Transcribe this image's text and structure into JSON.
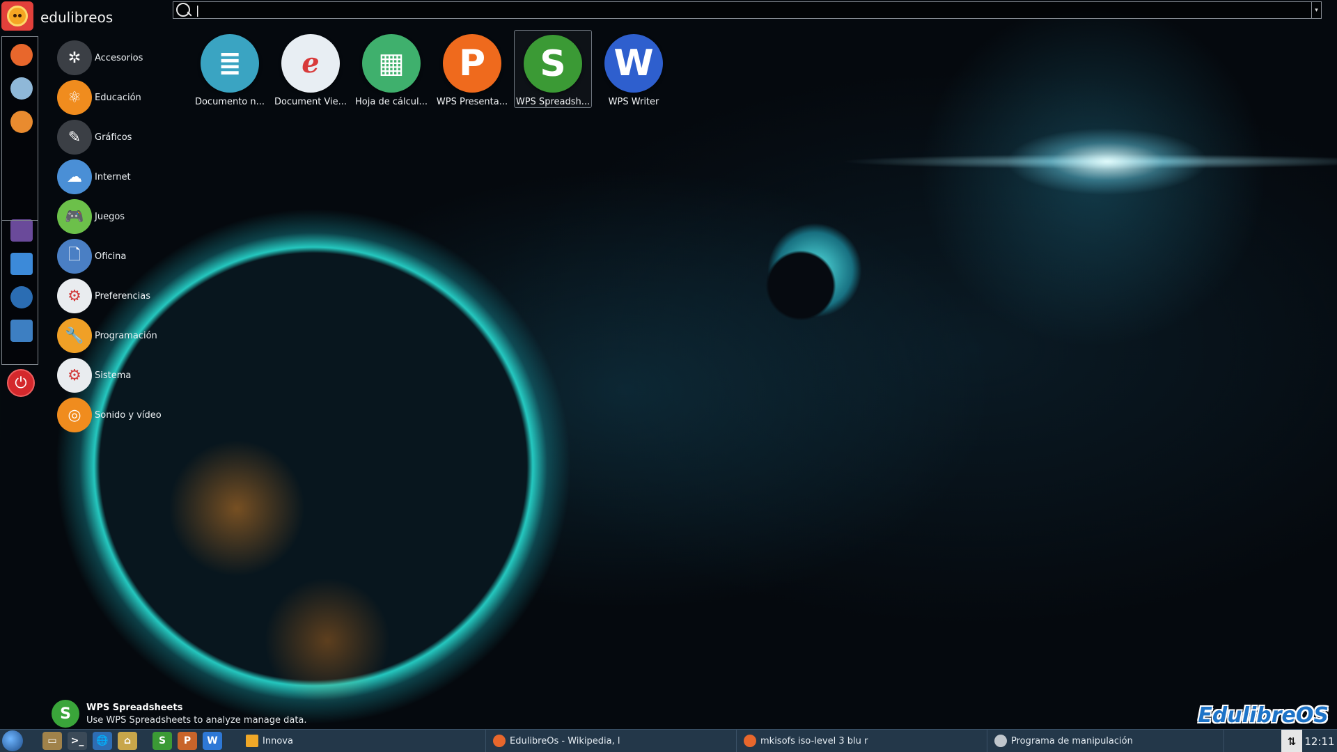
{
  "topbar": {
    "username": "edulibreos",
    "search_value": "",
    "search_caret": "|",
    "dropdown_glyph": "▾"
  },
  "dock": {
    "items": [
      {
        "name": "firefox-icon",
        "color": "#e8672c"
      },
      {
        "name": "bird-icon",
        "color": "#8fb8d8"
      },
      {
        "name": "fox-orange-icon",
        "color": "#e98b2f"
      },
      {
        "name": "settings-icon",
        "color": "#6a4a9a"
      },
      {
        "name": "monitor-icon",
        "color": "#3c8ad9"
      },
      {
        "name": "media-player-icon",
        "color": "#2b6db3"
      },
      {
        "name": "notes-icon",
        "color": "#3d7fc2"
      }
    ],
    "power_glyph": "⏻"
  },
  "categories": [
    {
      "label": "Accesorios",
      "color": "#3b3f45",
      "glyph": "✲"
    },
    {
      "label": "Educación",
      "color": "#f08c1e",
      "glyph": "⚛"
    },
    {
      "label": "Gráficos",
      "color": "#3b3f45",
      "glyph": "✎"
    },
    {
      "label": "Internet",
      "color": "#4a8fd6",
      "glyph": "☁"
    },
    {
      "label": "Juegos",
      "color": "#6cc04a",
      "glyph": "🎮"
    },
    {
      "label": "Oficina",
      "color": "#4a7fc4",
      "glyph": "🗋"
    },
    {
      "label": "Preferencias",
      "color": "#e9ecef",
      "glyph": "⚙"
    },
    {
      "label": "Programación",
      "color": "#f0a026",
      "glyph": "🔧"
    },
    {
      "label": "Sistema",
      "color": "#e9ecef",
      "glyph": "⚙"
    },
    {
      "label": "Sonido y vídeo",
      "color": "#f08c1e",
      "glyph": "◎"
    }
  ],
  "apps": [
    {
      "label": "Documento n...",
      "color": "#3aa4c2",
      "glyph": "≣"
    },
    {
      "label": "Document Vie...",
      "color": "#e8eef3",
      "glyph": "ℯ"
    },
    {
      "label": "Hoja de cálcul...",
      "color": "#3fb06d",
      "glyph": "▦"
    },
    {
      "label": "WPS Presenta...",
      "color": "#ef6a1d",
      "glyph": "P"
    },
    {
      "label": "WPS Spreadsh...",
      "color": "#3b9a35",
      "glyph": "S"
    },
    {
      "label": "WPS Writer",
      "color": "#2e5fce",
      "glyph": "W"
    }
  ],
  "selected_app_index": 4,
  "info": {
    "glyph": "S",
    "title": "WPS Spreadsheets",
    "description": "Use WPS Spreadsheets to analyze manage data."
  },
  "brand": "EdulibreOS",
  "taskbar": {
    "launchers": [
      {
        "name": "file-manager-launcher-icon",
        "color": "#a0824a",
        "glyph": "▭"
      },
      {
        "name": "terminal-launcher-icon",
        "color": "#3b4a58",
        "glyph": ">_"
      },
      {
        "name": "web-launcher-icon",
        "color": "#2e6db3",
        "glyph": "🌐"
      },
      {
        "name": "home-launcher-icon",
        "color": "#c8a64a",
        "glyph": "⌂"
      },
      {
        "name": "wps-spreadsheets-launcher-icon",
        "color": "#3b9a35",
        "glyph": "S"
      },
      {
        "name": "wps-presentation-launcher-icon",
        "color": "#c8642a",
        "glyph": "P"
      },
      {
        "name": "wps-writer-launcher-icon",
        "color": "#2e78d6",
        "glyph": "W"
      }
    ],
    "tasks": [
      {
        "label": "Innova",
        "color": "#f0a828"
      },
      {
        "label": "EdulibreOs - Wikipedia, l",
        "color": "#e8672c"
      },
      {
        "label": "mkisofs iso-level 3 blu r",
        "color": "#e8672c"
      },
      {
        "label": "Programa de manipulación",
        "color": "#c0c6cc"
      }
    ],
    "network_glyph": "⇅",
    "clock": "12:11"
  }
}
